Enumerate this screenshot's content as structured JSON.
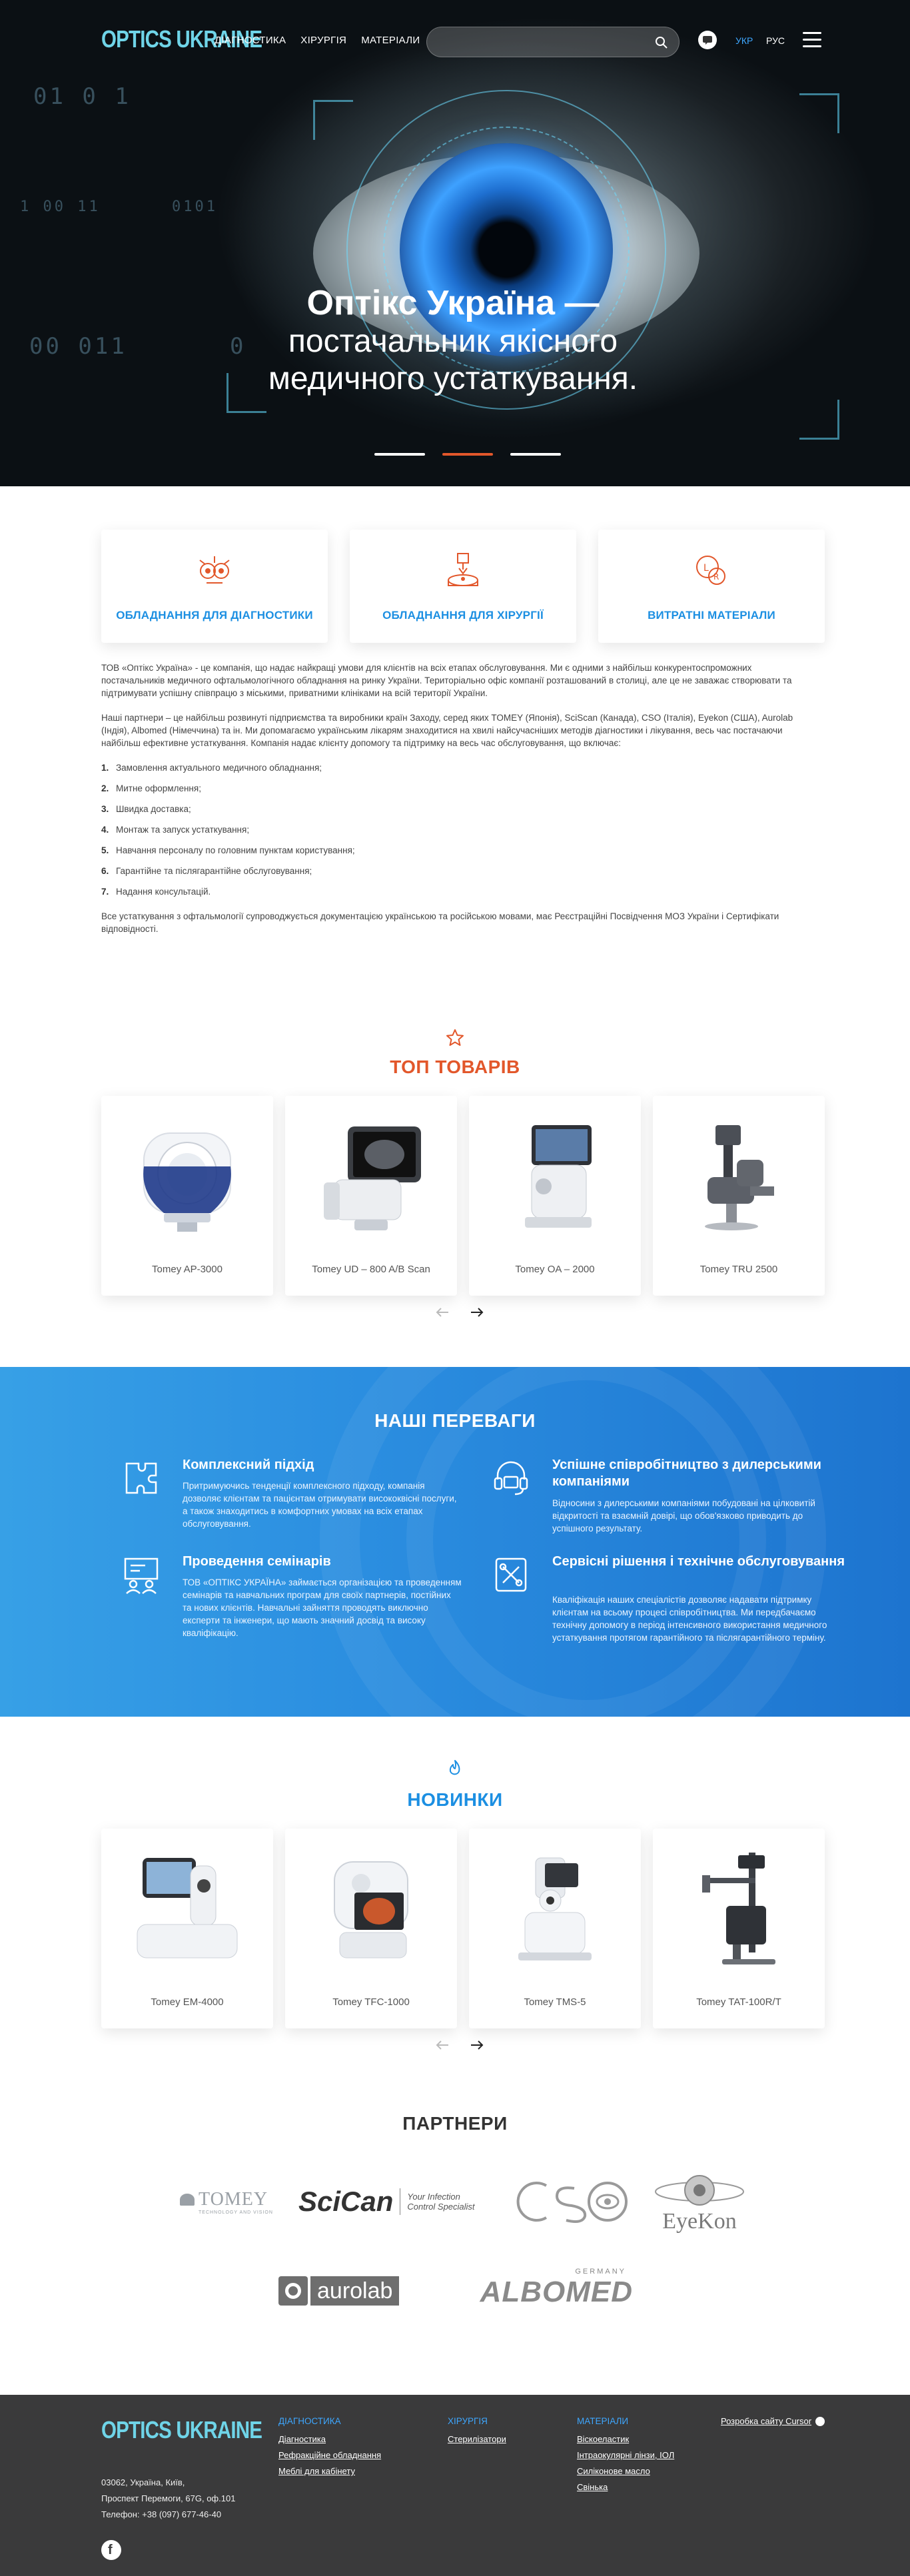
{
  "header": {
    "logo": "OPTICS UKRAINE",
    "nav": [
      "ДІАГНОСТИКА",
      "ХІРУРГІЯ",
      "МАТЕРІАЛИ"
    ],
    "search_placeholder": "",
    "lang_ukr": "УКР",
    "lang_rus": "РУС"
  },
  "hero": {
    "title_line1": "Оптікс Україна —",
    "title_line2": "постачальник якісного",
    "title_line3": "медичного устаткування.",
    "slides": 3,
    "active_slide": 2,
    "bg_digits": [
      "01  0  1",
      "1  00  11",
      "0101",
      "00  011",
      "0"
    ]
  },
  "categories": [
    {
      "label": "ОБЛАДНАННЯ ДЛЯ ДІАГНОСТИКИ",
      "icon": "diagnostics-icon"
    },
    {
      "label": "ОБЛАДНАННЯ ДЛЯ ХІРУРГІЇ",
      "icon": "surgery-icon"
    },
    {
      "label": "ВИТРАТНІ МАТЕРІАЛИ",
      "icon": "materials-icon"
    }
  ],
  "about": {
    "p1": "ТОВ «Оптікс Україна» - це компанія, що надає найкращі умови для клієнтів на всіх етапах обслуговування. Ми є одними з найбільш конкурентоспроможних постачальників медичного офтальмологічного обладнання на ринку України. Територіально офіс компанії розташований в столиці, але це не заважає створювати та підтримувати успішну співпрацю з міськими, приватними клініками на всій території України.",
    "p2": "Наші партнери – це найбільш розвинуті підприємства та виробники країн Заходу, серед яких TOMEY (Японія), SciScan (Канада), CSO (Італія), Eyekon (США), Aurolab (Індія), Albomed (Німеччина) та ін. Ми допомагаємо українським лікарям знаходитися на хвилі найсучасніших методів діагностики і лікування, весь час постачаючи найбільш ефективне устаткування. Компанія надає клієнту допомогу та підтримку на весь час обслуговування, що включає:",
    "list": [
      "Замовлення актуального медичного обладнання;",
      "Митне оформлення;",
      "Швидка доставка;",
      "Монтаж та запуск устаткування;",
      "Навчання персоналу по головним пунктам користування;",
      "Гарантійне та післягарантійне обслуговування;",
      "Надання консультацій."
    ],
    "p3": "Все устаткування з офтальмології супроводжується документацією українською та російською мовами, має Реєстраційні Посвідчення МОЗ України і Сертифікати відповідності."
  },
  "top_products": {
    "title": "ТОП ТОВАРІВ",
    "icon": "star-icon",
    "items": [
      "Tomey AP-3000",
      "Tomey UD – 800 A/B Scan",
      "Tomey OA – 2000",
      "Tomey TRU 2500"
    ]
  },
  "advantages": {
    "title": "НАШІ ПЕРЕВАГИ",
    "items": [
      {
        "title": "Комплексний підхід",
        "text": "Притримуючись тенденції комплексного підходу, компанія дозволяє клієнтам та пацієнтам отримувати висококвісні послуги, а також знаходитись в комфортних умовах на всіх етапах обслуговування.",
        "icon": "puzzle-icon"
      },
      {
        "title": "Успішне співробітництво з дилерськими компаніями",
        "text": "Відносини з дилерськими компаніями побудовані на цілковитій відкритості та взаємній довірі, що обов'язково приводить до успішного результату.",
        "icon": "support-icon"
      },
      {
        "title": "Проведення семінарів",
        "text": "ТОВ «ОПТІКС УКРАЇНА» займається організацією та проведенням семінарів та навчальних програм для своїх партнерів, постійних та нових клієнтів. Навчальні зайняття проводять виключно експерти та інженери, що мають значний досвід та високу кваліфікацію.",
        "icon": "seminar-icon"
      },
      {
        "title": "Сервісні рішення і технічне обслуговування",
        "text": "Кваліфікація наших спеціалістів дозволяє надавати підтримку клієнтам на всьому процесі співробітництва. Ми передбачаємо технічну допомогу в період інтенсивного використання медичного устаткування протягом гарантійного та післягарантійного терміну.",
        "icon": "tools-icon"
      }
    ]
  },
  "new_products": {
    "title": "НОВИНКИ",
    "icon": "flame-icon",
    "items": [
      "Tomey EM-4000",
      "Tomey TFC-1000",
      "Tomey TMS-5",
      "Tomey TAT-100R/T"
    ]
  },
  "partners": {
    "title": "ПАРТНЕРИ",
    "logos": [
      {
        "name": "TOMEY",
        "sub": "TECHNOLOGY AND VISION"
      },
      {
        "name": "SciCan",
        "sub": "Your Infection Control Specialist"
      },
      {
        "name": "CSO",
        "sub": ""
      },
      {
        "name": "EyeKon",
        "sub": ""
      },
      {
        "name": "aurolab",
        "sub": ""
      },
      {
        "name": "ALBOMED",
        "sub": "GERMANY"
      }
    ]
  },
  "footer": {
    "logo": "OPTICS UKRAINE",
    "col1": {
      "title": "ДІАГНОСТИКА",
      "links": [
        "Діагностика",
        "Рефракційне обладнання",
        "Меблі для кабінету"
      ]
    },
    "col2": {
      "title": "ХІРУРГІЯ",
      "links": [
        "Стерилізатори"
      ]
    },
    "col3": {
      "title": "МАТЕРІАЛИ",
      "links": [
        "Віскоеластик",
        "Інтраокулярні лінзи, ІОЛ",
        "Силіконове масло",
        "Свінька"
      ]
    },
    "dev": "Розробка сайту Cursor",
    "address": [
      "03062, Україна, Київ,",
      "Проспект Перемоги, 67G, оф.101",
      "Телефон: +38 (097) 677-46-40"
    ]
  },
  "colors": {
    "accent_blue": "#1c8fe2",
    "accent_orange": "#e2572b",
    "footer_bg": "#3a3a3b",
    "logo_cyan": "#6fd4e8"
  }
}
